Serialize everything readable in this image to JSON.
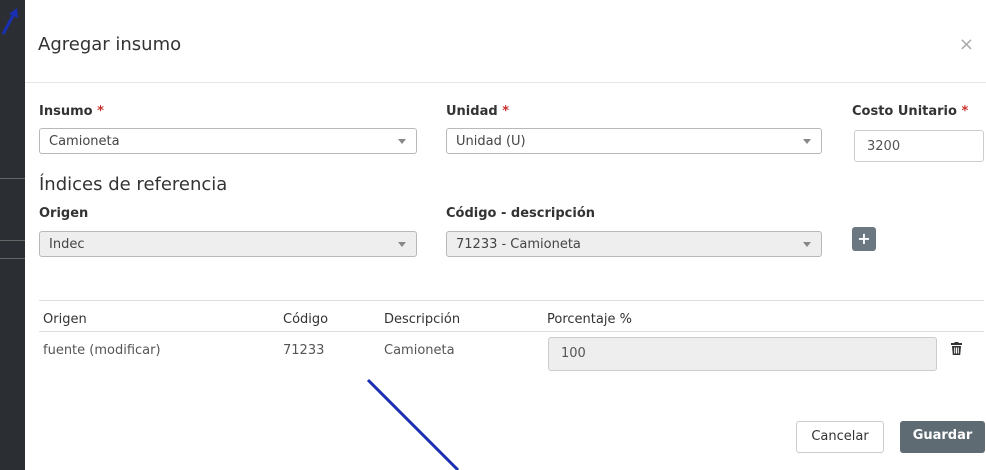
{
  "modal": {
    "title": "Agregar insumo",
    "close_glyph": "×",
    "close_icon": "close-icon"
  },
  "form": {
    "insumo": {
      "label": "Insumo",
      "required_mark": "*",
      "value": "Camioneta"
    },
    "unidad": {
      "label": "Unidad",
      "required_mark": "*",
      "value": "Unidad (U)"
    },
    "costo_unitario": {
      "label": "Costo Unitario",
      "required_mark": "*",
      "value": "3200"
    }
  },
  "referencias": {
    "title": "Índices de referencia",
    "origen": {
      "label": "Origen",
      "value": "Indec"
    },
    "codigo_descripcion": {
      "label": "Código - descripción",
      "value": "71233 - Camioneta"
    },
    "add_glyph": "+",
    "add_icon": "plus-icon"
  },
  "table": {
    "headers": [
      "Origen",
      "Código",
      "Descripción",
      "Porcentaje %"
    ],
    "rows": [
      {
        "origen": "fuente (modificar)",
        "codigo": "71233",
        "descripcion": "Camioneta",
        "porcentaje": "100",
        "delete_icon": "trash-icon"
      }
    ]
  },
  "footer": {
    "cancel_label": "Cancelar",
    "save_label": "Guardar"
  },
  "annotations": {
    "arrow_color": "#1a2fb3",
    "icons": [
      "corner-arrow-icon",
      "annotation-line"
    ]
  },
  "colors": {
    "required": "#c9302c",
    "primary_button": "#5f6b73",
    "disabled_field": "#eeeeee"
  }
}
